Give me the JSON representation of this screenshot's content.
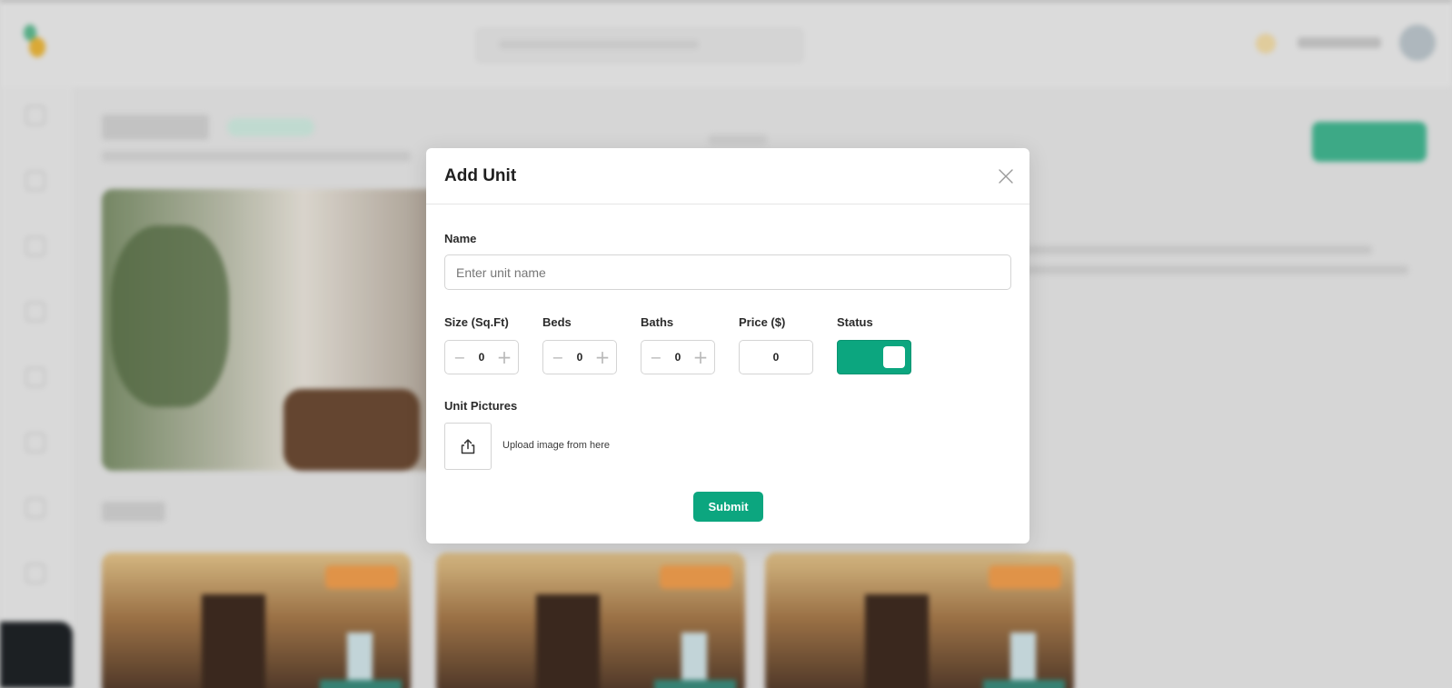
{
  "colors": {
    "accent": "#0ca67f",
    "modal_bg": "#ffffff",
    "page_bg": "#e4e4e4"
  },
  "modal": {
    "title": "Add Unit",
    "close_icon": "close-icon",
    "name": {
      "label": "Name",
      "placeholder": "Enter unit name",
      "value": ""
    },
    "size": {
      "label": "Size (Sq.Ft)",
      "value": "0",
      "decrement": "−",
      "increment": "+"
    },
    "beds": {
      "label": "Beds",
      "value": "0",
      "decrement": "−",
      "increment": "+"
    },
    "baths": {
      "label": "Baths",
      "value": "0",
      "decrement": "−",
      "increment": "+"
    },
    "price": {
      "label": "Price ($)",
      "value": "0"
    },
    "status": {
      "label": "Status",
      "enabled": true
    },
    "pictures": {
      "label": "Unit Pictures",
      "upload_icon": "upload-icon",
      "hint": "Upload image from here"
    },
    "submit_label": "Submit"
  }
}
